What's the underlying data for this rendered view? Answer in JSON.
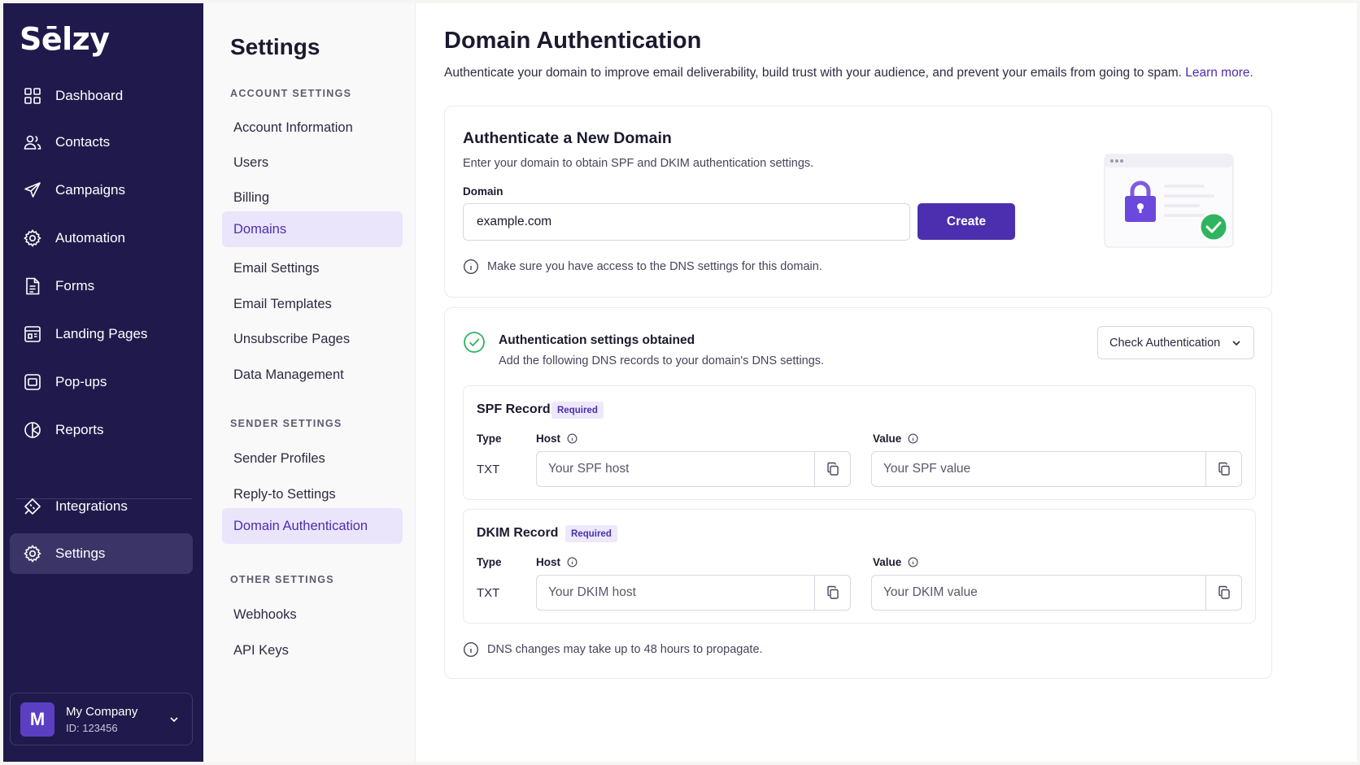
{
  "brand": {
    "logo": "Sēlzy",
    "primary": "#4b2fae",
    "nav_bg": "#201a4c",
    "success": "#2fb45f"
  },
  "nav": {
    "items": [
      {
        "label": "Dashboard",
        "icon": "grid-icon"
      },
      {
        "label": "Contacts",
        "icon": "users-icon"
      },
      {
        "label": "Campaigns",
        "icon": "send-icon"
      },
      {
        "label": "Automation",
        "icon": "gear-icon"
      },
      {
        "label": "Forms",
        "icon": "document-icon"
      },
      {
        "label": "Landing Pages",
        "icon": "layout-icon"
      },
      {
        "label": "Pop-ups",
        "icon": "popup-icon"
      },
      {
        "label": "Reports",
        "icon": "pie-chart-icon"
      },
      {
        "label": "Integrations",
        "icon": "plug-icon"
      },
      {
        "label": "Settings",
        "icon": "settings-icon",
        "active": true
      }
    ],
    "company": {
      "initial": "M",
      "name": "My Company",
      "id": "ID: 123456"
    }
  },
  "subnav": {
    "title": "Settings",
    "account_heading": "ACCOUNT SETTINGS",
    "account_items": [
      "Account Information",
      "Users",
      "Billing",
      "Domains",
      "Email Settings",
      "Email Templates",
      "Unsubscribe Pages",
      "Data Management"
    ],
    "sender_heading": "SENDER SETTINGS",
    "sender_items": [
      "Sender Profiles",
      "Reply-to Settings",
      "Domain Authentication"
    ],
    "other_heading": "OTHER SETTINGS",
    "other_items": [
      "Webhooks",
      "API Keys"
    ]
  },
  "main": {
    "title": "Domain Authentication",
    "description": "Authenticate your domain to improve email deliverability, build trust with your audience, and prevent your emails from going to spam.",
    "learn_more": "Learn more.",
    "new_domain": {
      "title": "Authenticate a New Domain",
      "subtitle": "Enter your domain to obtain SPF and DKIM authentication settings.",
      "label": "Domain",
      "value": "example.com",
      "button": "Create",
      "hint": "Make sure you have access to the DNS settings for this domain."
    },
    "obtained": {
      "title": "Authentication settings obtained",
      "subtitle": "Add the following DNS records to your domain's DNS settings.",
      "check_button": "Check Authentication",
      "spf": {
        "title": "SPF Record",
        "badge": "Required",
        "type_label": "Type",
        "host_label": "Host",
        "value_label": "Value",
        "type": "TXT",
        "host_placeholder": "Your SPF host",
        "value_placeholder": "Your SPF value"
      },
      "dkim": {
        "title": "DKIM Record",
        "badge": "Required",
        "type_label": "Type",
        "host_label": "Host",
        "value_label": "Value",
        "type": "TXT",
        "host_placeholder": "Your DKIM host",
        "value_placeholder": "Your DKIM value"
      },
      "hint": "DNS changes may take up to 48 hours to propagate."
    }
  }
}
